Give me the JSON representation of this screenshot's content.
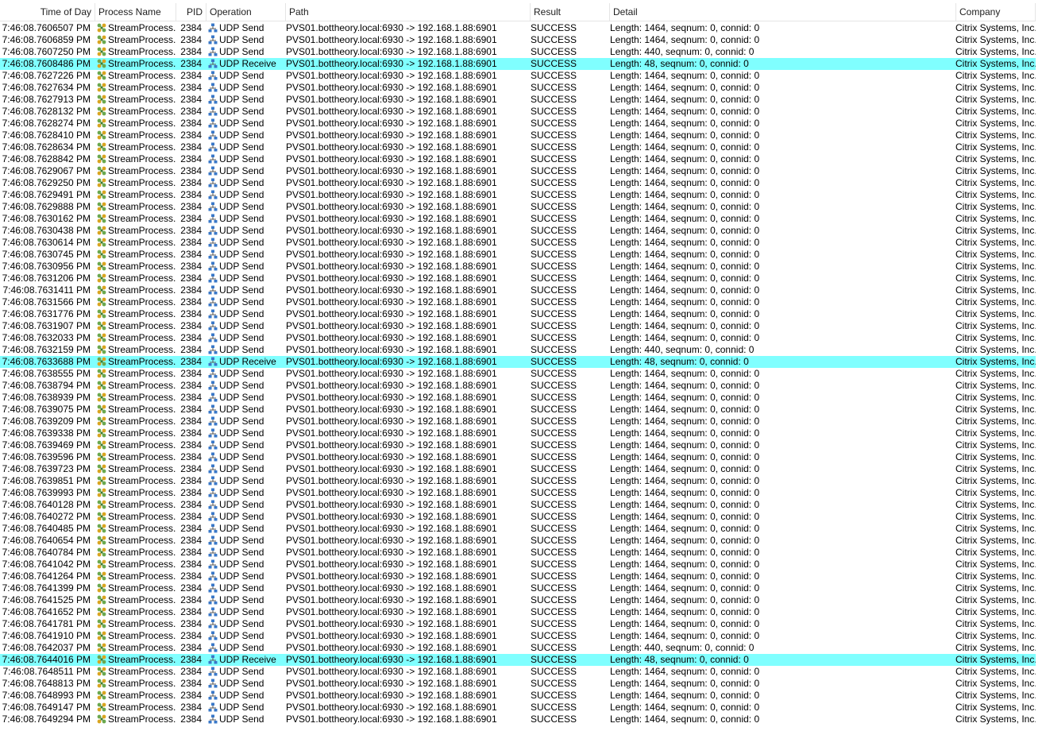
{
  "columns": {
    "time": "Time of Day",
    "process": "Process Name",
    "pid": "PID",
    "operation": "Operation",
    "path": "Path",
    "result": "Result",
    "detail": "Detail",
    "company": "Company"
  },
  "defaults": {
    "process": "StreamProcess....",
    "pid": "2384",
    "path": "PVS01.bottheory.local:6930 -> 192.168.1.88:6901",
    "result": "SUCCESS",
    "company": "Citrix Systems, Inc."
  },
  "operations": {
    "send": "UDP Send",
    "receive": "UDP Receive"
  },
  "details": {
    "d1464": "Length: 1464, seqnum: 0, connid: 0",
    "d440": "Length: 440, seqnum: 0, connid: 0",
    "d48": "Length: 48, seqnum: 0, connid: 0"
  },
  "colors": {
    "highlight": "#80ffff",
    "process_icon": "#6aa84f",
    "network_icon": "#3a78c8"
  },
  "icons": {
    "process": "stream-process-icon",
    "network": "network-icon"
  },
  "rows": [
    {
      "time": "7:46:08.7606507 PM",
      "op": "send",
      "det": "d1464"
    },
    {
      "time": "7:46:08.7606859 PM",
      "op": "send",
      "det": "d1464"
    },
    {
      "time": "7:46:08.7607250 PM",
      "op": "send",
      "det": "d440"
    },
    {
      "time": "7:46:08.7608486 PM",
      "op": "receive",
      "det": "d48",
      "hl": true
    },
    {
      "time": "7:46:08.7627226 PM",
      "op": "send",
      "det": "d1464"
    },
    {
      "time": "7:46:08.7627634 PM",
      "op": "send",
      "det": "d1464"
    },
    {
      "time": "7:46:08.7627913 PM",
      "op": "send",
      "det": "d1464"
    },
    {
      "time": "7:46:08.7628132 PM",
      "op": "send",
      "det": "d1464"
    },
    {
      "time": "7:46:08.7628274 PM",
      "op": "send",
      "det": "d1464"
    },
    {
      "time": "7:46:08.7628410 PM",
      "op": "send",
      "det": "d1464"
    },
    {
      "time": "7:46:08.7628634 PM",
      "op": "send",
      "det": "d1464"
    },
    {
      "time": "7:46:08.7628842 PM",
      "op": "send",
      "det": "d1464"
    },
    {
      "time": "7:46:08.7629067 PM",
      "op": "send",
      "det": "d1464"
    },
    {
      "time": "7:46:08.7629250 PM",
      "op": "send",
      "det": "d1464"
    },
    {
      "time": "7:46:08.7629491 PM",
      "op": "send",
      "det": "d1464"
    },
    {
      "time": "7:46:08.7629888 PM",
      "op": "send",
      "det": "d1464"
    },
    {
      "time": "7:46:08.7630162 PM",
      "op": "send",
      "det": "d1464"
    },
    {
      "time": "7:46:08.7630438 PM",
      "op": "send",
      "det": "d1464"
    },
    {
      "time": "7:46:08.7630614 PM",
      "op": "send",
      "det": "d1464"
    },
    {
      "time": "7:46:08.7630745 PM",
      "op": "send",
      "det": "d1464"
    },
    {
      "time": "7:46:08.7630956 PM",
      "op": "send",
      "det": "d1464"
    },
    {
      "time": "7:46:08.7631206 PM",
      "op": "send",
      "det": "d1464"
    },
    {
      "time": "7:46:08.7631411 PM",
      "op": "send",
      "det": "d1464"
    },
    {
      "time": "7:46:08.7631566 PM",
      "op": "send",
      "det": "d1464"
    },
    {
      "time": "7:46:08.7631776 PM",
      "op": "send",
      "det": "d1464"
    },
    {
      "time": "7:46:08.7631907 PM",
      "op": "send",
      "det": "d1464"
    },
    {
      "time": "7:46:08.7632033 PM",
      "op": "send",
      "det": "d1464"
    },
    {
      "time": "7:46:08.7632159 PM",
      "op": "send",
      "det": "d440"
    },
    {
      "time": "7:46:08.7633688 PM",
      "op": "receive",
      "det": "d48",
      "hl": true
    },
    {
      "time": "7:46:08.7638555 PM",
      "op": "send",
      "det": "d1464"
    },
    {
      "time": "7:46:08.7638794 PM",
      "op": "send",
      "det": "d1464"
    },
    {
      "time": "7:46:08.7638939 PM",
      "op": "send",
      "det": "d1464"
    },
    {
      "time": "7:46:08.7639075 PM",
      "op": "send",
      "det": "d1464"
    },
    {
      "time": "7:46:08.7639209 PM",
      "op": "send",
      "det": "d1464"
    },
    {
      "time": "7:46:08.7639338 PM",
      "op": "send",
      "det": "d1464"
    },
    {
      "time": "7:46:08.7639469 PM",
      "op": "send",
      "det": "d1464"
    },
    {
      "time": "7:46:08.7639596 PM",
      "op": "send",
      "det": "d1464"
    },
    {
      "time": "7:46:08.7639723 PM",
      "op": "send",
      "det": "d1464"
    },
    {
      "time": "7:46:08.7639851 PM",
      "op": "send",
      "det": "d1464"
    },
    {
      "time": "7:46:08.7639993 PM",
      "op": "send",
      "det": "d1464"
    },
    {
      "time": "7:46:08.7640128 PM",
      "op": "send",
      "det": "d1464"
    },
    {
      "time": "7:46:08.7640272 PM",
      "op": "send",
      "det": "d1464"
    },
    {
      "time": "7:46:08.7640485 PM",
      "op": "send",
      "det": "d1464"
    },
    {
      "time": "7:46:08.7640654 PM",
      "op": "send",
      "det": "d1464"
    },
    {
      "time": "7:46:08.7640784 PM",
      "op": "send",
      "det": "d1464"
    },
    {
      "time": "7:46:08.7641042 PM",
      "op": "send",
      "det": "d1464"
    },
    {
      "time": "7:46:08.7641264 PM",
      "op": "send",
      "det": "d1464"
    },
    {
      "time": "7:46:08.7641399 PM",
      "op": "send",
      "det": "d1464"
    },
    {
      "time": "7:46:08.7641525 PM",
      "op": "send",
      "det": "d1464"
    },
    {
      "time": "7:46:08.7641652 PM",
      "op": "send",
      "det": "d1464"
    },
    {
      "time": "7:46:08.7641781 PM",
      "op": "send",
      "det": "d1464"
    },
    {
      "time": "7:46:08.7641910 PM",
      "op": "send",
      "det": "d1464"
    },
    {
      "time": "7:46:08.7642037 PM",
      "op": "send",
      "det": "d440"
    },
    {
      "time": "7:46:08.7644016 PM",
      "op": "receive",
      "det": "d48",
      "hl": true
    },
    {
      "time": "7:46:08.7648511 PM",
      "op": "send",
      "det": "d1464"
    },
    {
      "time": "7:46:08.7648813 PM",
      "op": "send",
      "det": "d1464"
    },
    {
      "time": "7:46:08.7648993 PM",
      "op": "send",
      "det": "d1464"
    },
    {
      "time": "7:46:08.7649147 PM",
      "op": "send",
      "det": "d1464"
    },
    {
      "time": "7:46:08.7649294 PM",
      "op": "send",
      "det": "d1464"
    }
  ]
}
